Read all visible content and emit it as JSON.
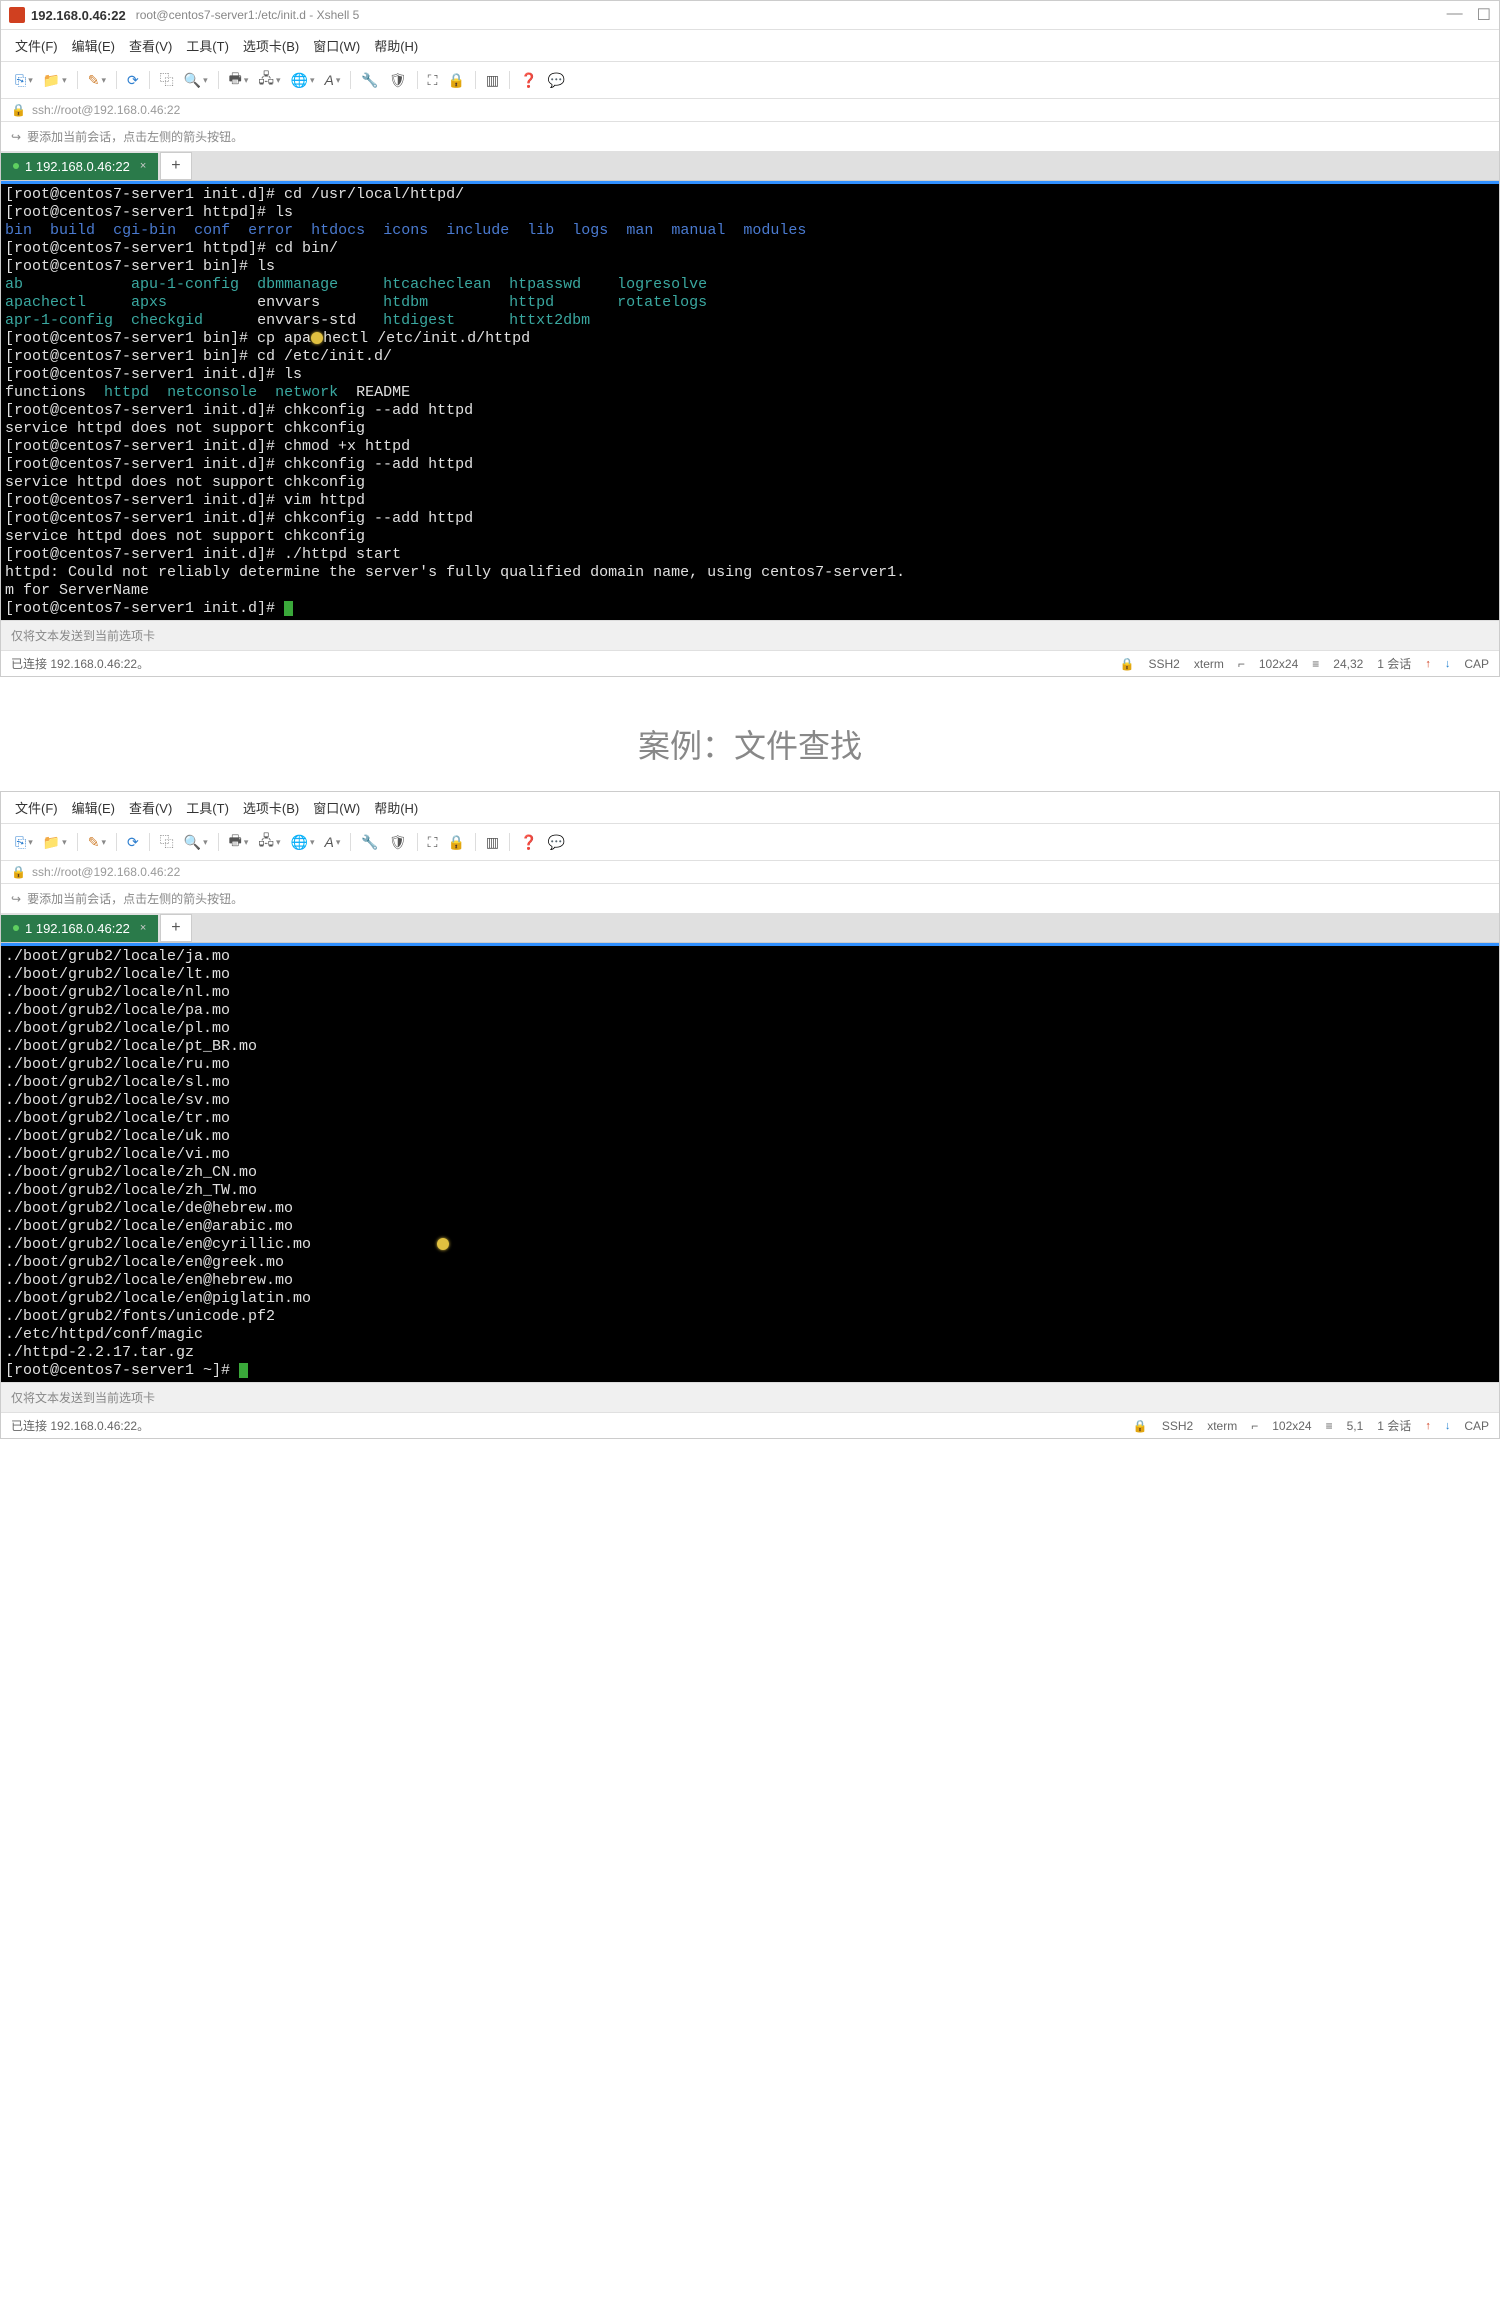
{
  "w1": {
    "titlebar": {
      "ip": "192.168.0.46:22",
      "path": "root@centos7-server1:/etc/init.d - Xshell 5"
    },
    "menu": [
      "文件(F)",
      "编辑(E)",
      "查看(V)",
      "工具(T)",
      "选项卡(B)",
      "窗口(W)",
      "帮助(H)"
    ],
    "addr": "ssh://root@192.168.0.46:22",
    "info": "要添加当前会话，点击左侧的箭头按钮。",
    "tab": "1 192.168.0.46:22",
    "hint": "仅将文本发送到当前选项卡",
    "status": {
      "conn": "已连接 192.168.0.46:22。",
      "ssh": "SSH2",
      "term": "xterm",
      "size": "102x24",
      "pos": "24,32",
      "sess": "1 会话",
      "cap": "CAP"
    },
    "term": {
      "p1": "[root@centos7-server1 init.d]# ",
      "c1": "cd /usr/local/httpd/",
      "p2": "[root@centos7-server1 httpd]# ",
      "c2": "ls",
      "ls1": [
        "bin",
        "build",
        "cgi-bin",
        "conf",
        "error",
        "htdocs",
        "icons",
        "include",
        "lib",
        "logs",
        "man",
        "manual",
        "modules"
      ],
      "c3": "cd bin/",
      "p3": "[root@centos7-server1 bin]# ",
      "c4": "ls",
      "bin_cyan_col1": [
        "ab",
        "apachectl",
        "apr-1-config"
      ],
      "bin_cyan_col2": [
        "apu-1-config",
        "apxs",
        "checkgid"
      ],
      "bin_col3": [
        "dbmmanage",
        "envvars",
        "envvars-std"
      ],
      "bin_col3_colors": [
        "cyan",
        "white",
        "white"
      ],
      "bin_cyan_col4": [
        "htcacheclean",
        "htdbm",
        "htdigest"
      ],
      "bin_cyan_col5": [
        "htpasswd",
        "httpd",
        "httxt2dbm"
      ],
      "bin_cyan_col6": [
        "logresolve",
        "rotatelogs",
        ""
      ],
      "c5a": "cp apa",
      "c5b": "hectl /etc/init.d/httpd",
      "c6": "cd /etc/init.d/",
      "c7": "ls",
      "ls3_w1": "functions",
      "ls3_c1": "httpd",
      "ls3_c2": "netconsole",
      "ls3_c3": "network",
      "ls3_w2": "README",
      "c8": "chkconfig --add httpd",
      "r1": "service httpd does not support chkconfig",
      "c9": "chmod +x httpd",
      "c10": "vim httpd",
      "c11": "./httpd start",
      "r_httpd1": "httpd: Could not reliably determine the server's fully qualified domain name, using centos7-server1.",
      "r_httpd2": "m for ServerName"
    }
  },
  "sectionTitle": "案例：文件查找",
  "w2": {
    "menu": [
      "文件(F)",
      "编辑(E)",
      "查看(V)",
      "工具(T)",
      "选项卡(B)",
      "窗口(W)",
      "帮助(H)"
    ],
    "addr": "ssh://root@192.168.0.46:22",
    "info": "要添加当前会话，点击左侧的箭头按钮。",
    "tab": "1 192.168.0.46:22",
    "hint": "仅将文本发送到当前选项卡",
    "status": {
      "conn": "已连接 192.168.0.46:22。",
      "ssh": "SSH2",
      "term": "xterm",
      "size": "102x24",
      "pos": "5,1",
      "sess": "1 会话",
      "cap": "CAP"
    },
    "files": [
      "./boot/grub2/locale/ja.mo",
      "./boot/grub2/locale/lt.mo",
      "./boot/grub2/locale/nl.mo",
      "./boot/grub2/locale/pa.mo",
      "./boot/grub2/locale/pl.mo",
      "./boot/grub2/locale/pt_BR.mo",
      "./boot/grub2/locale/ru.mo",
      "./boot/grub2/locale/sl.mo",
      "./boot/grub2/locale/sv.mo",
      "./boot/grub2/locale/tr.mo",
      "./boot/grub2/locale/uk.mo",
      "./boot/grub2/locale/vi.mo",
      "./boot/grub2/locale/zh_CN.mo",
      "./boot/grub2/locale/zh_TW.mo",
      "./boot/grub2/locale/de@hebrew.mo",
      "./boot/grub2/locale/en@arabic.mo",
      "./boot/grub2/locale/en@cyrillic.mo",
      "./boot/grub2/locale/en@greek.mo",
      "./boot/grub2/locale/en@hebrew.mo",
      "./boot/grub2/locale/en@piglatin.mo",
      "./boot/grub2/fonts/unicode.pf2",
      "./etc/httpd/conf/magic",
      "./httpd-2.2.17.tar.gz"
    ],
    "prompt": "[root@centos7-server1 ~]# "
  }
}
